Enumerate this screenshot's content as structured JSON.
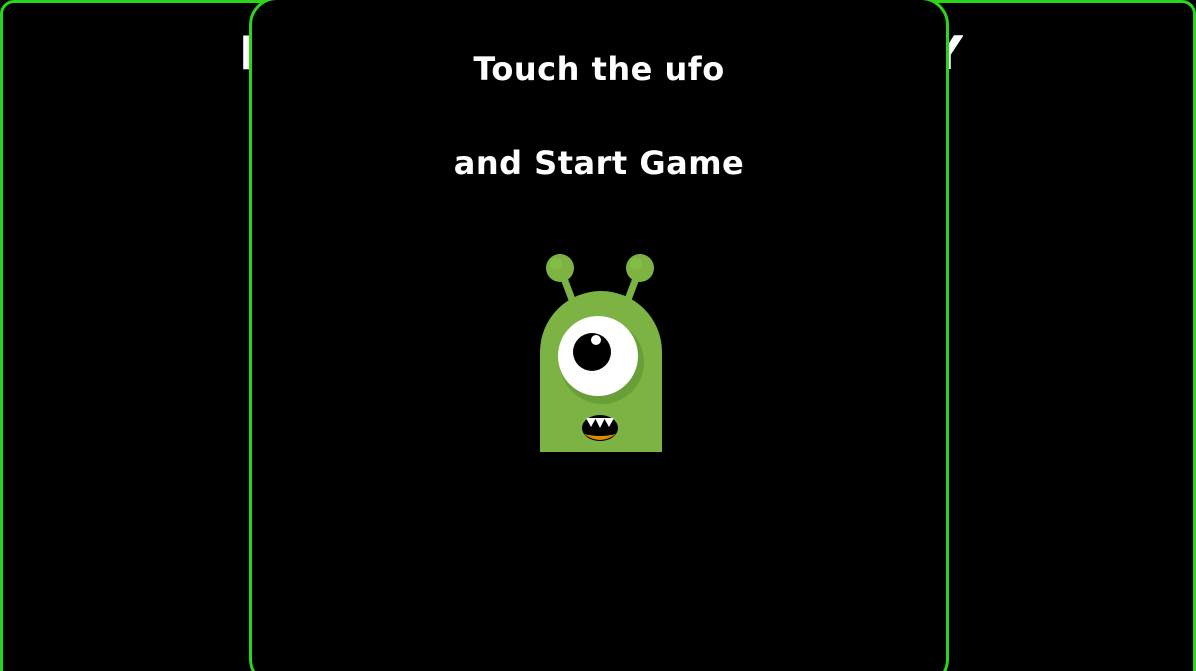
{
  "background": {
    "title_left": "P",
    "title_right": "Y"
  },
  "modal": {
    "line1": "Touch the ufo",
    "line2": "and Start Game"
  },
  "alien": {
    "icon": "alien-monster-icon",
    "body_color": "#7cb342",
    "eye_color": "#ffffff",
    "pupil_color": "#000000",
    "tongue_color": "#e08a00"
  },
  "colors": {
    "frame_border": "#2bd61a",
    "background": "#000000",
    "text": "#ffffff"
  }
}
